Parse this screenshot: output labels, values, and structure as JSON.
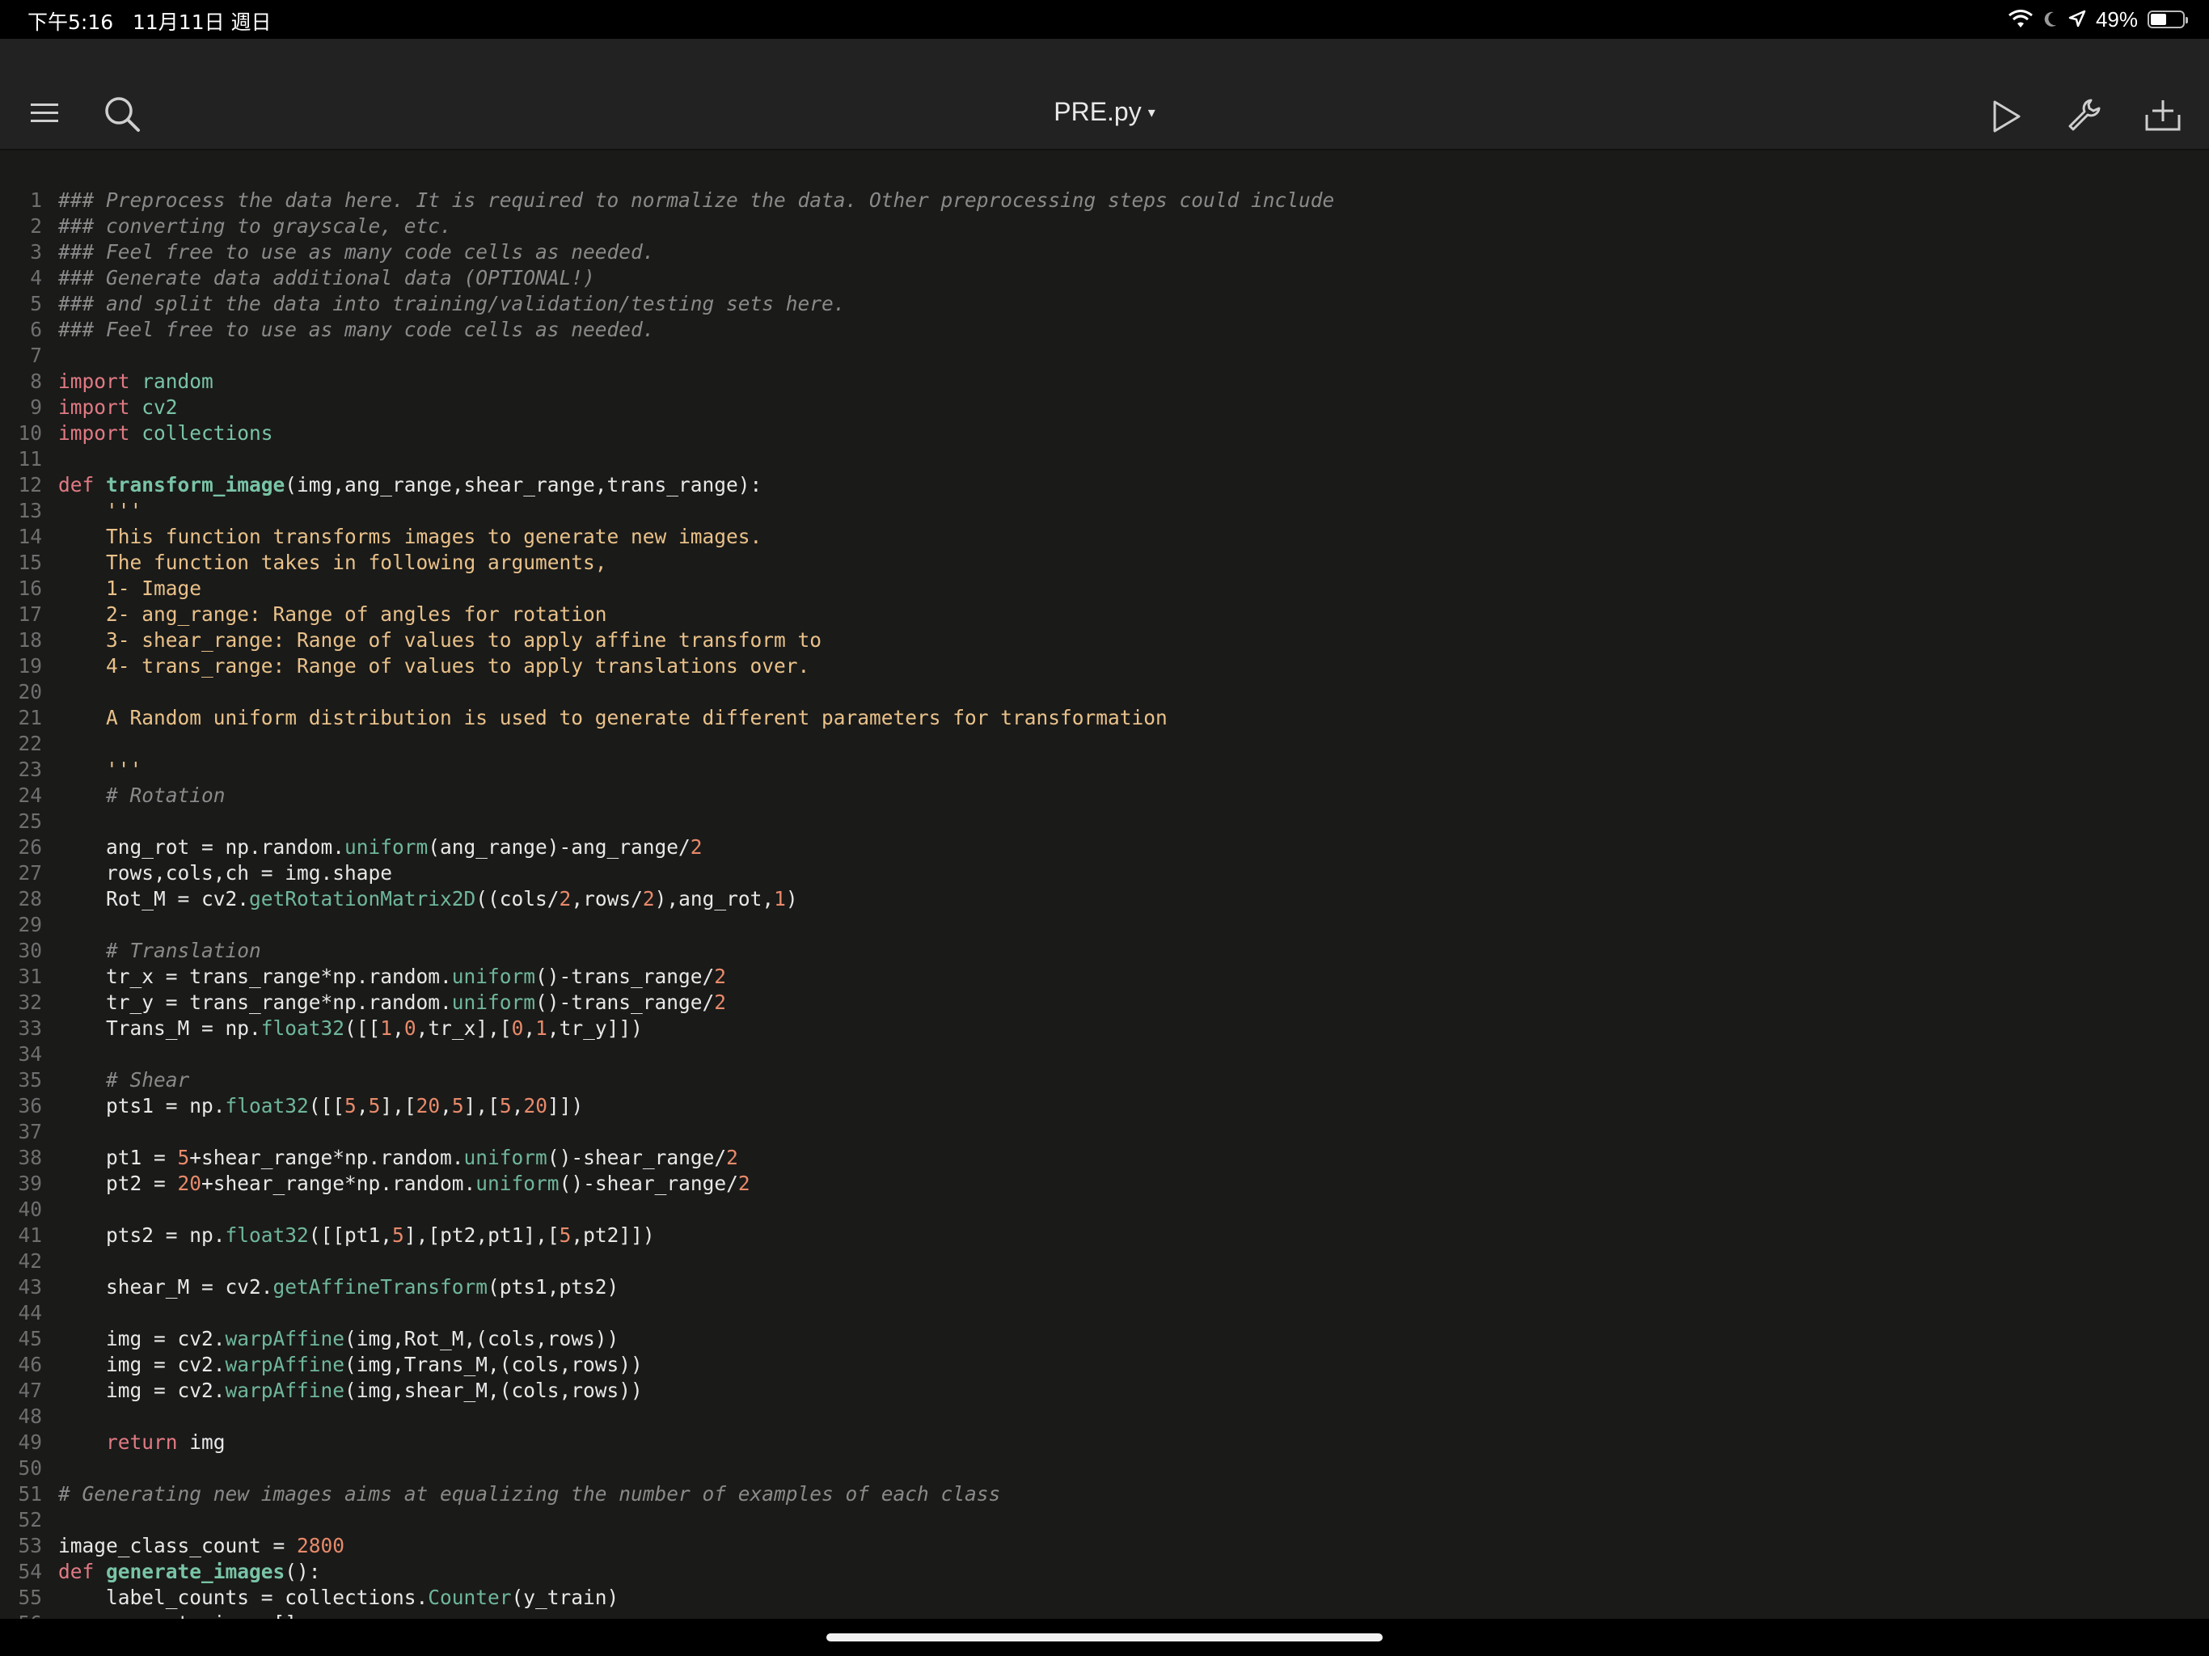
{
  "status_bar": {
    "time_date": "下午5:16   11月11日 週日",
    "battery_text": "49%",
    "battery_level": 0.49
  },
  "toolbar": {
    "file_title": "PRE.py",
    "title_caret": "▾",
    "icons": [
      "menu-icon",
      "search-icon",
      "run-icon",
      "wrench-icon",
      "add-icon"
    ]
  },
  "colors": {
    "comment": "#8a8a8a",
    "keyword": "#e07a83",
    "module": "#79c4a6",
    "string": "#e9c189",
    "number": "#e88a6a"
  },
  "code": [
    {
      "n": "1",
      "seg": [
        [
          "cmt",
          "### Preprocess the data here. It is required to normalize the data. Other preprocessing steps could include"
        ]
      ]
    },
    {
      "n": "2",
      "seg": [
        [
          "cmt",
          "### converting to grayscale, etc."
        ]
      ]
    },
    {
      "n": "3",
      "seg": [
        [
          "cmt",
          "### Feel free to use as many code cells as needed."
        ]
      ]
    },
    {
      "n": "4",
      "seg": [
        [
          "cmt",
          "### Generate data additional data (OPTIONAL!)"
        ]
      ]
    },
    {
      "n": "5",
      "seg": [
        [
          "cmt",
          "### and split the data into training/validation/testing sets here."
        ]
      ]
    },
    {
      "n": "6",
      "seg": [
        [
          "cmt",
          "### Feel free to use as many code cells as needed."
        ]
      ]
    },
    {
      "n": "7",
      "seg": []
    },
    {
      "n": "8",
      "seg": [
        [
          "kw",
          "import"
        ],
        [
          "",
          " "
        ],
        [
          "mod",
          "random"
        ]
      ]
    },
    {
      "n": "9",
      "seg": [
        [
          "kw",
          "import"
        ],
        [
          "",
          " "
        ],
        [
          "mod",
          "cv2"
        ]
      ]
    },
    {
      "n": "10",
      "seg": [
        [
          "kw",
          "import"
        ],
        [
          "",
          " "
        ],
        [
          "mod",
          "collections"
        ]
      ]
    },
    {
      "n": "11",
      "seg": []
    },
    {
      "n": "12",
      "seg": [
        [
          "kw",
          "def"
        ],
        [
          "",
          " "
        ],
        [
          "fn",
          "transform_image"
        ],
        [
          "",
          "(img,ang_range,shear_range,trans_range):"
        ]
      ]
    },
    {
      "n": "13",
      "seg": [
        [
          "",
          "    "
        ],
        [
          "str",
          "'''"
        ]
      ]
    },
    {
      "n": "14",
      "seg": [
        [
          "str",
          "    This function transforms images to generate new images."
        ]
      ]
    },
    {
      "n": "15",
      "seg": [
        [
          "str",
          "    The function takes in following arguments,"
        ]
      ]
    },
    {
      "n": "16",
      "seg": [
        [
          "str",
          "    1- Image"
        ]
      ]
    },
    {
      "n": "17",
      "seg": [
        [
          "str",
          "    2- ang_range: Range of angles for rotation"
        ]
      ]
    },
    {
      "n": "18",
      "seg": [
        [
          "str",
          "    3- shear_range: Range of values to apply affine transform to"
        ]
      ]
    },
    {
      "n": "19",
      "seg": [
        [
          "str",
          "    4- trans_range: Range of values to apply translations over."
        ]
      ]
    },
    {
      "n": "20",
      "seg": []
    },
    {
      "n": "21",
      "seg": [
        [
          "str",
          "    A Random uniform distribution is used to generate different parameters for transformation"
        ]
      ]
    },
    {
      "n": "22",
      "seg": []
    },
    {
      "n": "23",
      "seg": [
        [
          "",
          "    "
        ],
        [
          "str",
          "'''"
        ]
      ]
    },
    {
      "n": "24",
      "seg": [
        [
          "",
          "    "
        ],
        [
          "cmt",
          "# Rotation"
        ]
      ]
    },
    {
      "n": "25",
      "seg": []
    },
    {
      "n": "26",
      "seg": [
        [
          "",
          "    ang_rot = np.random."
        ],
        [
          "call",
          "uniform"
        ],
        [
          "",
          "(ang_range)-ang_range/"
        ],
        [
          "num",
          "2"
        ]
      ]
    },
    {
      "n": "27",
      "seg": [
        [
          "",
          "    rows,cols,ch = img.shape"
        ]
      ]
    },
    {
      "n": "28",
      "seg": [
        [
          "",
          "    Rot_M = cv2."
        ],
        [
          "call",
          "getRotationMatrix2D"
        ],
        [
          "",
          "((cols/"
        ],
        [
          "num",
          "2"
        ],
        [
          "",
          ",rows/"
        ],
        [
          "num",
          "2"
        ],
        [
          "",
          "),ang_rot,"
        ],
        [
          "num",
          "1"
        ],
        [
          "",
          ")"
        ]
      ]
    },
    {
      "n": "29",
      "seg": []
    },
    {
      "n": "30",
      "seg": [
        [
          "",
          "    "
        ],
        [
          "cmt",
          "# Translation"
        ]
      ]
    },
    {
      "n": "31",
      "seg": [
        [
          "",
          "    tr_x = trans_range*np.random."
        ],
        [
          "call",
          "uniform"
        ],
        [
          "",
          "()-trans_range/"
        ],
        [
          "num",
          "2"
        ]
      ]
    },
    {
      "n": "32",
      "seg": [
        [
          "",
          "    tr_y = trans_range*np.random."
        ],
        [
          "call",
          "uniform"
        ],
        [
          "",
          "()-trans_range/"
        ],
        [
          "num",
          "2"
        ]
      ]
    },
    {
      "n": "33",
      "seg": [
        [
          "",
          "    Trans_M = np."
        ],
        [
          "call",
          "float32"
        ],
        [
          "",
          "([["
        ],
        [
          "num",
          "1"
        ],
        [
          "",
          ","
        ],
        [
          "num",
          "0"
        ],
        [
          "",
          ",tr_x],["
        ],
        [
          "num",
          "0"
        ],
        [
          "",
          ","
        ],
        [
          "num",
          "1"
        ],
        [
          "",
          ",tr_y]])"
        ]
      ]
    },
    {
      "n": "34",
      "seg": []
    },
    {
      "n": "35",
      "seg": [
        [
          "",
          "    "
        ],
        [
          "cmt",
          "# Shear"
        ]
      ]
    },
    {
      "n": "36",
      "seg": [
        [
          "",
          "    pts1 = np."
        ],
        [
          "call",
          "float32"
        ],
        [
          "",
          "([["
        ],
        [
          "num",
          "5"
        ],
        [
          "",
          ","
        ],
        [
          "num",
          "5"
        ],
        [
          "",
          "],["
        ],
        [
          "num",
          "20"
        ],
        [
          "",
          ","
        ],
        [
          "num",
          "5"
        ],
        [
          "",
          "],["
        ],
        [
          "num",
          "5"
        ],
        [
          "",
          ","
        ],
        [
          "num",
          "20"
        ],
        [
          "",
          "]])"
        ]
      ]
    },
    {
      "n": "37",
      "seg": []
    },
    {
      "n": "38",
      "seg": [
        [
          "",
          "    pt1 = "
        ],
        [
          "num",
          "5"
        ],
        [
          "",
          "+shear_range*np.random."
        ],
        [
          "call",
          "uniform"
        ],
        [
          "",
          "()-shear_range/"
        ],
        [
          "num",
          "2"
        ]
      ]
    },
    {
      "n": "39",
      "seg": [
        [
          "",
          "    pt2 = "
        ],
        [
          "num",
          "20"
        ],
        [
          "",
          "+shear_range*np.random."
        ],
        [
          "call",
          "uniform"
        ],
        [
          "",
          "()-shear_range/"
        ],
        [
          "num",
          "2"
        ]
      ]
    },
    {
      "n": "40",
      "seg": []
    },
    {
      "n": "41",
      "seg": [
        [
          "",
          "    pts2 = np."
        ],
        [
          "call",
          "float32"
        ],
        [
          "",
          "([[pt1,"
        ],
        [
          "num",
          "5"
        ],
        [
          "",
          "],[pt2,pt1],["
        ],
        [
          "num",
          "5"
        ],
        [
          "",
          ",pt2]])"
        ]
      ]
    },
    {
      "n": "42",
      "seg": []
    },
    {
      "n": "43",
      "seg": [
        [
          "",
          "    shear_M = cv2."
        ],
        [
          "call",
          "getAffineTransform"
        ],
        [
          "",
          "(pts1,pts2)"
        ]
      ]
    },
    {
      "n": "44",
      "seg": []
    },
    {
      "n": "45",
      "seg": [
        [
          "",
          "    img = cv2."
        ],
        [
          "call",
          "warpAffine"
        ],
        [
          "",
          "(img,Rot_M,(cols,rows))"
        ]
      ]
    },
    {
      "n": "46",
      "seg": [
        [
          "",
          "    img = cv2."
        ],
        [
          "call",
          "warpAffine"
        ],
        [
          "",
          "(img,Trans_M,(cols,rows))"
        ]
      ]
    },
    {
      "n": "47",
      "seg": [
        [
          "",
          "    img = cv2."
        ],
        [
          "call",
          "warpAffine"
        ],
        [
          "",
          "(img,shear_M,(cols,rows))"
        ]
      ]
    },
    {
      "n": "48",
      "seg": []
    },
    {
      "n": "49",
      "seg": [
        [
          "",
          "    "
        ],
        [
          "kw",
          "return"
        ],
        [
          "",
          " img"
        ]
      ]
    },
    {
      "n": "50",
      "seg": []
    },
    {
      "n": "51",
      "seg": [
        [
          "cmt",
          "# Generating new images aims at equalizing the number of examples of each class"
        ]
      ]
    },
    {
      "n": "52",
      "seg": []
    },
    {
      "n": "53",
      "seg": [
        [
          "",
          "image_class_count = "
        ],
        [
          "num",
          "2800"
        ]
      ]
    },
    {
      "n": "54",
      "seg": [
        [
          "kw",
          "def"
        ],
        [
          "",
          " "
        ],
        [
          "fn",
          "generate_images"
        ],
        [
          "",
          "():"
        ]
      ]
    },
    {
      "n": "55",
      "seg": [
        [
          "",
          "    label_counts = collections."
        ],
        [
          "call",
          "Counter"
        ],
        [
          "",
          "(y_train)"
        ]
      ]
    },
    {
      "n": "56",
      "seg": [
        [
          "",
          "    new_x_train = []"
        ]
      ]
    }
  ]
}
